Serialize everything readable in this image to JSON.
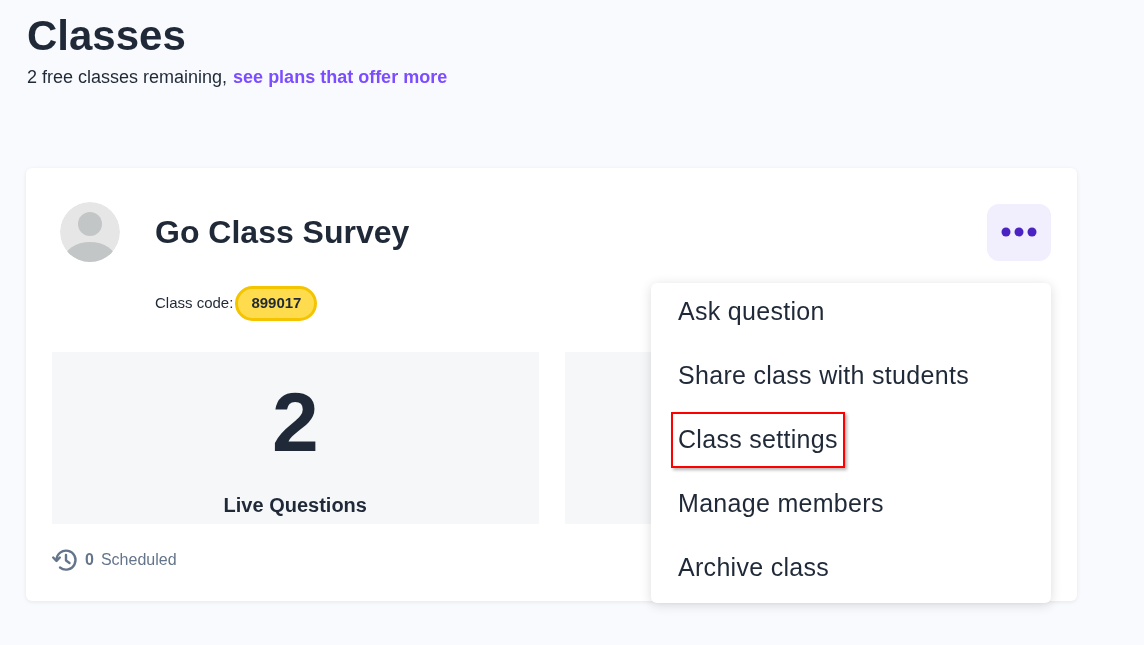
{
  "header": {
    "title": "Classes",
    "subtitle": "2 free classes remaining,",
    "subtitle_link": "see plans that offer more"
  },
  "class_card": {
    "name": "Go Class Survey",
    "code_label": "Class code:",
    "code": "899017",
    "stats": [
      {
        "value": "2",
        "label": "Live Questions"
      }
    ],
    "scheduled": {
      "count": "0",
      "label": "Scheduled"
    },
    "menu": {
      "open": true,
      "items": [
        {
          "label": "Ask question",
          "highlighted": false
        },
        {
          "label": "Share class with students",
          "highlighted": false
        },
        {
          "label": "Class settings",
          "highlighted": true
        },
        {
          "label": "Manage members",
          "highlighted": false
        },
        {
          "label": "Archive class",
          "highlighted": false
        }
      ]
    }
  }
}
